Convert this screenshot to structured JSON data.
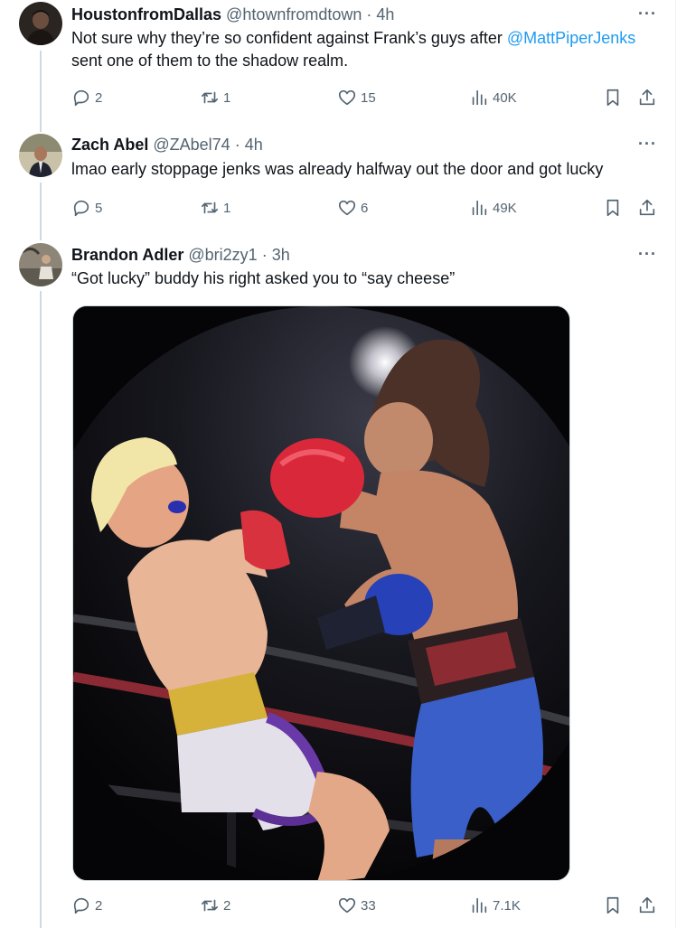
{
  "tweets": [
    {
      "name": "HoustonfromDallas",
      "handle": "@htownfromdtown",
      "time": "4h",
      "text_before": "Not sure why they’re so confident against Frank’s guys after ",
      "mention": "@MattPiperJenks",
      "text_after": " sent one of them to the shadow realm.",
      "replies": "2",
      "reposts": "1",
      "likes": "15",
      "views": "40K"
    },
    {
      "name": "Zach Abel",
      "handle": "@ZAbel74",
      "time": "4h",
      "text": "lmao early stoppage jenks was already halfway out the door and got lucky",
      "replies": "5",
      "reposts": "1",
      "likes": "6",
      "views": "49K"
    },
    {
      "name": "Brandon Adler",
      "handle": "@bri2zy1",
      "time": "3h",
      "text": "“Got lucky” buddy his right asked you to “say cheese”",
      "replies": "2",
      "reposts": "2",
      "likes": "33",
      "views": "7.1K"
    }
  ],
  "meta_separator": "·",
  "more_glyph": "···",
  "icons": [
    "reply-icon",
    "repost-icon",
    "like-icon",
    "views-icon",
    "bookmark-icon",
    "share-icon"
  ],
  "colors": {
    "link": "#1d9bf0",
    "muted": "#536471",
    "text": "#0f1419"
  }
}
